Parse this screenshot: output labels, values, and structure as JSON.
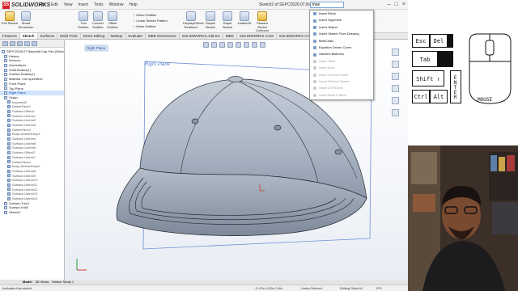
{
  "app": {
    "brand": "SOLIDWORKS",
    "menu": [
      "File",
      "Edit",
      "View",
      "Insert",
      "Tools",
      "Window",
      "Help"
    ],
    "document_title": "Sketch2 of SEPC2026.07.Baseball.Ca...",
    "search_value": "inse"
  },
  "ribbon": {
    "buttons": [
      {
        "label": "Exit Sketch",
        "active": true
      },
      {
        "label": "Smart Dimension"
      },
      {
        "label": "Trim Entities"
      },
      {
        "label": "Convert Entities"
      },
      {
        "label": "Offset Entities"
      },
      {
        "label": "Display/Delete Relations"
      },
      {
        "label": "Repair Sketch"
      },
      {
        "label": "Rapid Sketch"
      },
      {
        "label": "Instant2D"
      },
      {
        "label": "Shaded Sketch Contours",
        "active": true
      }
    ],
    "lists": [
      [
        "Mirror Entities",
        "Linear Sketch Pattern",
        "Move Entities"
      ]
    ]
  },
  "tabs": [
    "Features",
    "Sketch",
    "Surfaces",
    "Mold Tools",
    "Direct Editing",
    "Markup",
    "Evaluate",
    "MBD Dimensions",
    "SOLIDWORKS Add-Ins",
    "MBD",
    "SOLIDWORKS CAM",
    "SOLIDWORKS CAM TBM"
  ],
  "active_tab": "Sketch",
  "feature_tree": [
    {
      "label": "SEPC2026.07.Baseball.Cap.Part (Default<<D",
      "type": "root"
    },
    {
      "label": "History"
    },
    {
      "label": "Sensors"
    },
    {
      "label": "Annotations"
    },
    {
      "label": "Solid Bodies(1)"
    },
    {
      "label": "Surface Bodies(1)"
    },
    {
      "label": "Material <not specified>"
    },
    {
      "label": "Front Plane"
    },
    {
      "label": "Top Plane"
    },
    {
      "label": "Right Plane",
      "selected": true
    },
    {
      "label": "Origin"
    },
    {
      "label": "Imported2",
      "type": "suppressed"
    },
    {
      "label": "DeleteFace2",
      "type": "suppressed"
    },
    {
      "label": "Surface-Offset1",
      "type": "suppressed"
    },
    {
      "label": "Surface-Untrim1",
      "type": "suppressed"
    },
    {
      "label": "Surface-Untrim2",
      "type": "suppressed"
    },
    {
      "label": "Surface-Untrim3",
      "type": "suppressed"
    },
    {
      "label": "DeleteFace3",
      "type": "suppressed"
    },
    {
      "label": "Body-Delete/Keep1",
      "type": "suppressed"
    },
    {
      "label": "Surface-Untrim4",
      "type": "suppressed"
    },
    {
      "label": "Surface-Untrim5",
      "type": "suppressed"
    },
    {
      "label": "Surface-Untrim6",
      "type": "suppressed"
    },
    {
      "label": "Surface-Offset2",
      "type": "suppressed"
    },
    {
      "label": "Surface-Untrim7",
      "type": "suppressed"
    },
    {
      "label": "DeleteFace4",
      "type": "suppressed"
    },
    {
      "label": "Body-Delete/Keep2",
      "type": "suppressed"
    },
    {
      "label": "Surface-Untrim8",
      "type": "suppressed"
    },
    {
      "label": "Surface-Untrim9",
      "type": "suppressed"
    },
    {
      "label": "Surface-Untrim10",
      "type": "suppressed"
    },
    {
      "label": "Surface-Untrim11",
      "type": "suppressed"
    },
    {
      "label": "Surface-Untrim12",
      "type": "suppressed"
    },
    {
      "label": "Surface-Untrim13",
      "type": "suppressed"
    },
    {
      "label": "Surface-Untrim14",
      "type": "suppressed"
    },
    {
      "label": "Surface-Trim1"
    },
    {
      "label": "Surface-Knit2"
    },
    {
      "label": "Sketch2"
    }
  ],
  "viewport": {
    "plane_label": "Right Plane",
    "tree_plane_label": "Right Plane"
  },
  "search_dropdown": [
    {
      "label": "Insert Block",
      "enabled": true
    },
    {
      "label": "Insert Hyperlink",
      "enabled": true
    },
    {
      "label": "Insert Object",
      "enabled": true
    },
    {
      "label": "Insert Sketch From Drawing",
      "enabled": true
    },
    {
      "label": "Belt/Chain",
      "enabled": true
    },
    {
      "label": "Equation Driven Curve",
      "enabled": true
    },
    {
      "label": "Stacked Balloons",
      "enabled": true
    },
    {
      "label": "Insert Table",
      "enabled": false
    },
    {
      "label": "Insert Note",
      "enabled": false
    },
    {
      "label": "Insert Control Points",
      "enabled": false
    },
    {
      "label": "Insert Derived Sketch",
      "enabled": false
    },
    {
      "label": "Insert DXF/DWG",
      "enabled": false
    },
    {
      "label": "Insert Mold Folders",
      "enabled": false
    }
  ],
  "view_tabs": [
    "Model",
    "3D Views",
    "Motion Study 1"
  ],
  "active_view_tab": "Model",
  "status": {
    "left": "Activates this sketch",
    "coords": "-0.47in   4.02in   0.6in",
    "state": "Under Defined",
    "mode": "Editing Sketch2",
    "units": "IPS"
  },
  "keyboard_overlay": {
    "keys": [
      "Esc",
      "Del",
      "Tab",
      "Shift ↑",
      "Ctrl",
      "Alt",
      "ENTER"
    ],
    "mouse_label": "MOUSE"
  }
}
